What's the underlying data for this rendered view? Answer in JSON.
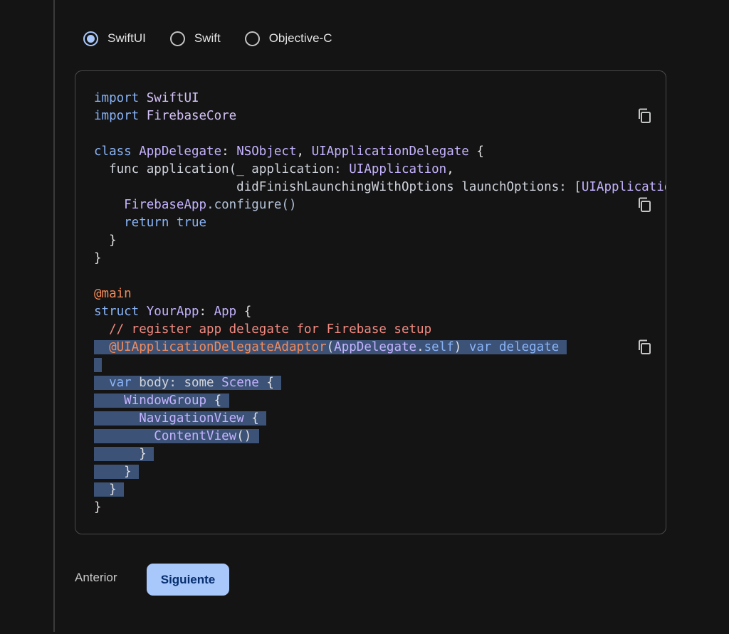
{
  "platform_options": [
    {
      "label": "SwiftUI",
      "selected": true
    },
    {
      "label": "Swift",
      "selected": false
    },
    {
      "label": "Objective-C",
      "selected": false
    }
  ],
  "code": {
    "lines": [
      {
        "highlight": false,
        "tokens": [
          {
            "t": "import ",
            "c": "k"
          },
          {
            "t": "SwiftUI",
            "c": "n"
          }
        ]
      },
      {
        "highlight": false,
        "tokens": [
          {
            "t": "import ",
            "c": "k"
          },
          {
            "t": "FirebaseCore",
            "c": "n"
          }
        ]
      },
      {
        "highlight": false,
        "tokens": []
      },
      {
        "highlight": false,
        "tokens": [
          {
            "t": "class ",
            "c": "k"
          },
          {
            "t": "AppDelegate",
            "c": "t"
          },
          {
            "t": ": ",
            "c": "p"
          },
          {
            "t": "NSObject",
            "c": "t"
          },
          {
            "t": ", ",
            "c": "p"
          },
          {
            "t": "UIApplicationDelegate",
            "c": "t"
          },
          {
            "t": " {",
            "c": "p"
          }
        ]
      },
      {
        "highlight": false,
        "tokens": [
          {
            "t": "  func ",
            "c": "d"
          },
          {
            "t": "application",
            "c": "d"
          },
          {
            "t": "(_ application: ",
            "c": "d"
          },
          {
            "t": "UIApplication",
            "c": "t"
          },
          {
            "t": ",",
            "c": "p"
          }
        ]
      },
      {
        "highlight": false,
        "tokens": [
          {
            "t": "                   didFinishLaunchingWithOptions launchOptions: [",
            "c": "d"
          },
          {
            "t": "UIApplicationLaunchOptionsKey",
            "c": "t"
          }
        ]
      },
      {
        "highlight": false,
        "tokens": [
          {
            "t": "    ",
            "c": "p"
          },
          {
            "t": "FirebaseApp",
            "c": "t"
          },
          {
            "t": ".configure()",
            "c": "m"
          }
        ]
      },
      {
        "highlight": false,
        "tokens": [
          {
            "t": "    return true",
            "c": "k"
          }
        ]
      },
      {
        "highlight": false,
        "tokens": [
          {
            "t": "  }",
            "c": "p"
          }
        ]
      },
      {
        "highlight": false,
        "tokens": [
          {
            "t": "}",
            "c": "p"
          }
        ]
      },
      {
        "highlight": false,
        "tokens": []
      },
      {
        "highlight": false,
        "tokens": [
          {
            "t": "@main",
            "c": "a"
          }
        ]
      },
      {
        "highlight": false,
        "tokens": [
          {
            "t": "struct ",
            "c": "k"
          },
          {
            "t": "YourApp",
            "c": "t"
          },
          {
            "t": ": ",
            "c": "p"
          },
          {
            "t": "App",
            "c": "t"
          },
          {
            "t": " {",
            "c": "p"
          }
        ]
      },
      {
        "highlight": false,
        "tokens": [
          {
            "t": "  // register app delegate for Firebase setup",
            "c": "c"
          }
        ]
      },
      {
        "highlight": true,
        "tokens": [
          {
            "t": "  ",
            "c": "p"
          },
          {
            "t": "@UIApplicationDelegateAdaptor",
            "c": "a"
          },
          {
            "t": "(",
            "c": "p"
          },
          {
            "t": "AppDelegate",
            "c": "t"
          },
          {
            "t": ".",
            "c": "p"
          },
          {
            "t": "self",
            "c": "k"
          },
          {
            "t": ") ",
            "c": "p"
          },
          {
            "t": "var delegate ",
            "c": "k"
          }
        ]
      },
      {
        "highlight": true,
        "tokens": [
          {
            "t": " ",
            "c": "p"
          }
        ]
      },
      {
        "highlight": true,
        "tokens": [
          {
            "t": "  ",
            "c": "p"
          },
          {
            "t": "var ",
            "c": "k"
          },
          {
            "t": "body: some ",
            "c": "d"
          },
          {
            "t": "Scene",
            "c": "t"
          },
          {
            "t": " { ",
            "c": "p"
          }
        ]
      },
      {
        "highlight": true,
        "tokens": [
          {
            "t": "    ",
            "c": "p"
          },
          {
            "t": "WindowGroup",
            "c": "t"
          },
          {
            "t": " { ",
            "c": "p"
          }
        ]
      },
      {
        "highlight": true,
        "tokens": [
          {
            "t": "      ",
            "c": "p"
          },
          {
            "t": "NavigationView",
            "c": "t"
          },
          {
            "t": " { ",
            "c": "p"
          }
        ]
      },
      {
        "highlight": true,
        "tokens": [
          {
            "t": "        ",
            "c": "p"
          },
          {
            "t": "ContentView",
            "c": "t"
          },
          {
            "t": "() ",
            "c": "p"
          }
        ]
      },
      {
        "highlight": true,
        "tokens": [
          {
            "t": "      } ",
            "c": "p"
          }
        ]
      },
      {
        "highlight": true,
        "tokens": [
          {
            "t": "    } ",
            "c": "p"
          }
        ]
      },
      {
        "highlight": true,
        "tokens": [
          {
            "t": "  } ",
            "c": "p"
          }
        ]
      },
      {
        "highlight": false,
        "tokens": [
          {
            "t": "}",
            "c": "p"
          }
        ]
      }
    ]
  },
  "copy_icon": "copy-icon",
  "nav": {
    "prev_label": "Anterior",
    "next_label": "Siguiente"
  },
  "colors": {
    "accent": "#a8c7fa",
    "selection": "#3c5276",
    "background": "#141414"
  }
}
